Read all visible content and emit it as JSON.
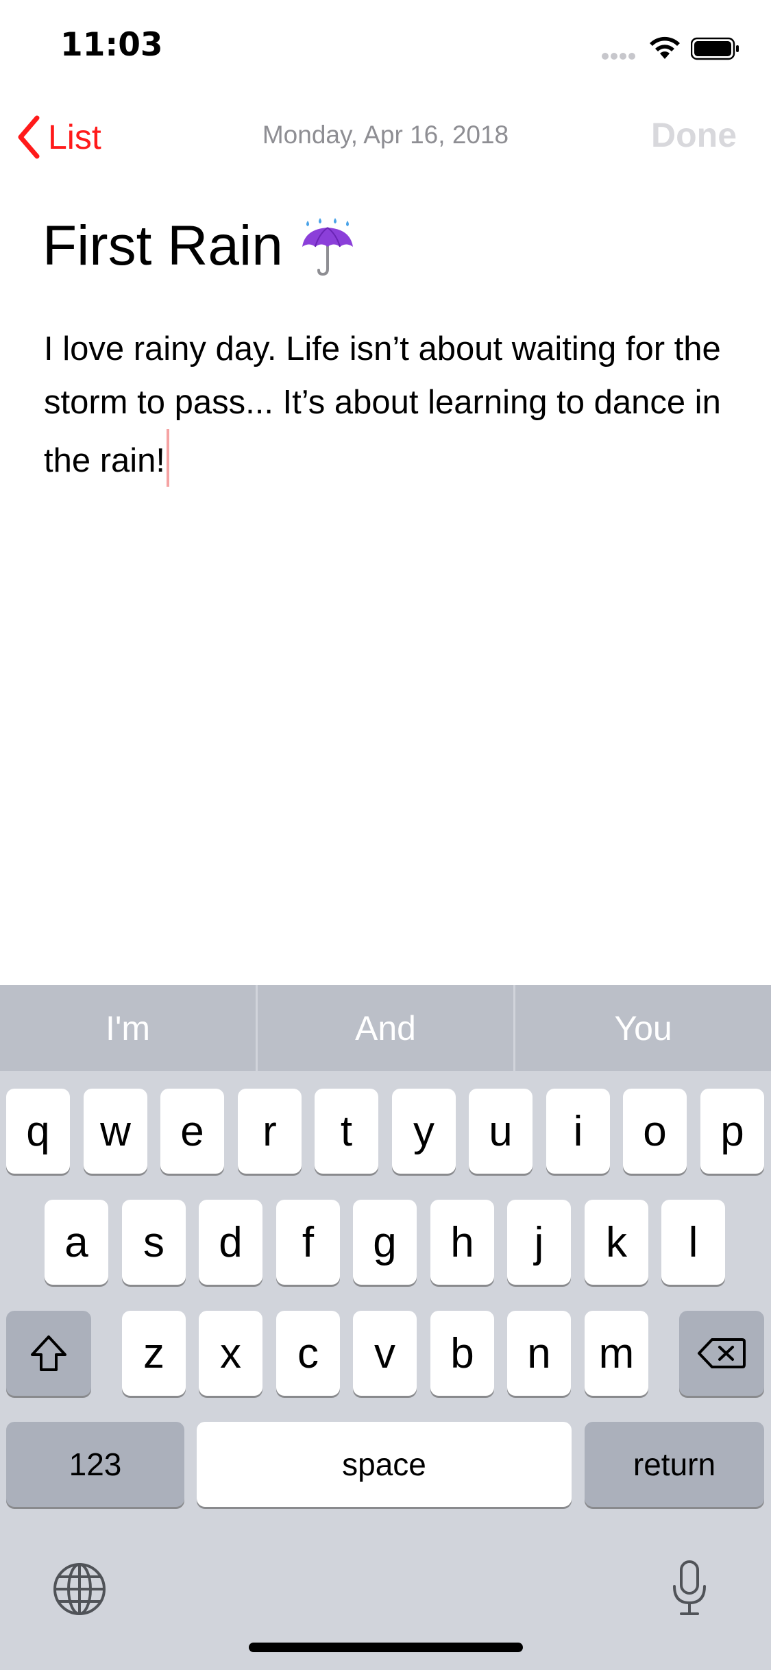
{
  "status_bar": {
    "time": "11:03",
    "icons": [
      "signal-dots-icon",
      "wifi-icon",
      "battery-icon"
    ]
  },
  "nav": {
    "back_label": "List",
    "date": "Monday, Apr 16, 2018",
    "done_label": "Done"
  },
  "note": {
    "title": "First Rain",
    "title_icon": "umbrella-with-rain-icon",
    "body": "I love rainy day. Life isn’t about waiting for the storm to pass... It’s about learning to dance in the rain!"
  },
  "keyboard": {
    "suggestions": [
      "I'm",
      "And",
      "You"
    ],
    "row1": [
      "q",
      "w",
      "e",
      "r",
      "t",
      "y",
      "u",
      "i",
      "o",
      "p"
    ],
    "row2": [
      "a",
      "s",
      "d",
      "f",
      "g",
      "h",
      "j",
      "k",
      "l"
    ],
    "row3": [
      "z",
      "x",
      "c",
      "v",
      "b",
      "n",
      "m"
    ],
    "numbers_label": "123",
    "space_label": "space",
    "return_label": "return",
    "icons": [
      "shift-icon",
      "delete-icon",
      "globe-icon",
      "microphone-icon"
    ]
  },
  "colors": {
    "accent": "#ff1a1a",
    "done_disabled": "#d8d8dc",
    "keyboard_bg": "#d1d4db",
    "suggestion_bar_bg": "#bbbfc8"
  }
}
